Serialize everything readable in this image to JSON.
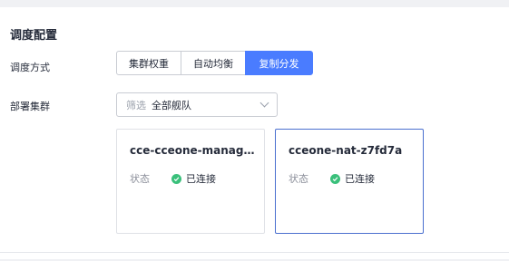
{
  "section": {
    "title": "调度配置"
  },
  "schedule": {
    "label": "调度方式",
    "options": [
      "集群权重",
      "自动均衡",
      "复制分发"
    ],
    "selected": "复制分发"
  },
  "deploy": {
    "label": "部署集群",
    "filter_prefix": "筛选",
    "filter_value": "全部舰队"
  },
  "clusters": [
    {
      "name": "cce-cceone-manage...",
      "status_label": "状态",
      "status": "已连接",
      "selected": false
    },
    {
      "name": "cceone-nat-z7fd7a",
      "status_label": "状态",
      "status": "已连接",
      "selected": true
    }
  ],
  "colors": {
    "accent": "#4a7cff",
    "success": "#3ac07b",
    "selected_border": "#4a6fcf"
  },
  "icons": {
    "status_ok": "check-circle-icon",
    "dropdown": "chevron-down-icon"
  }
}
